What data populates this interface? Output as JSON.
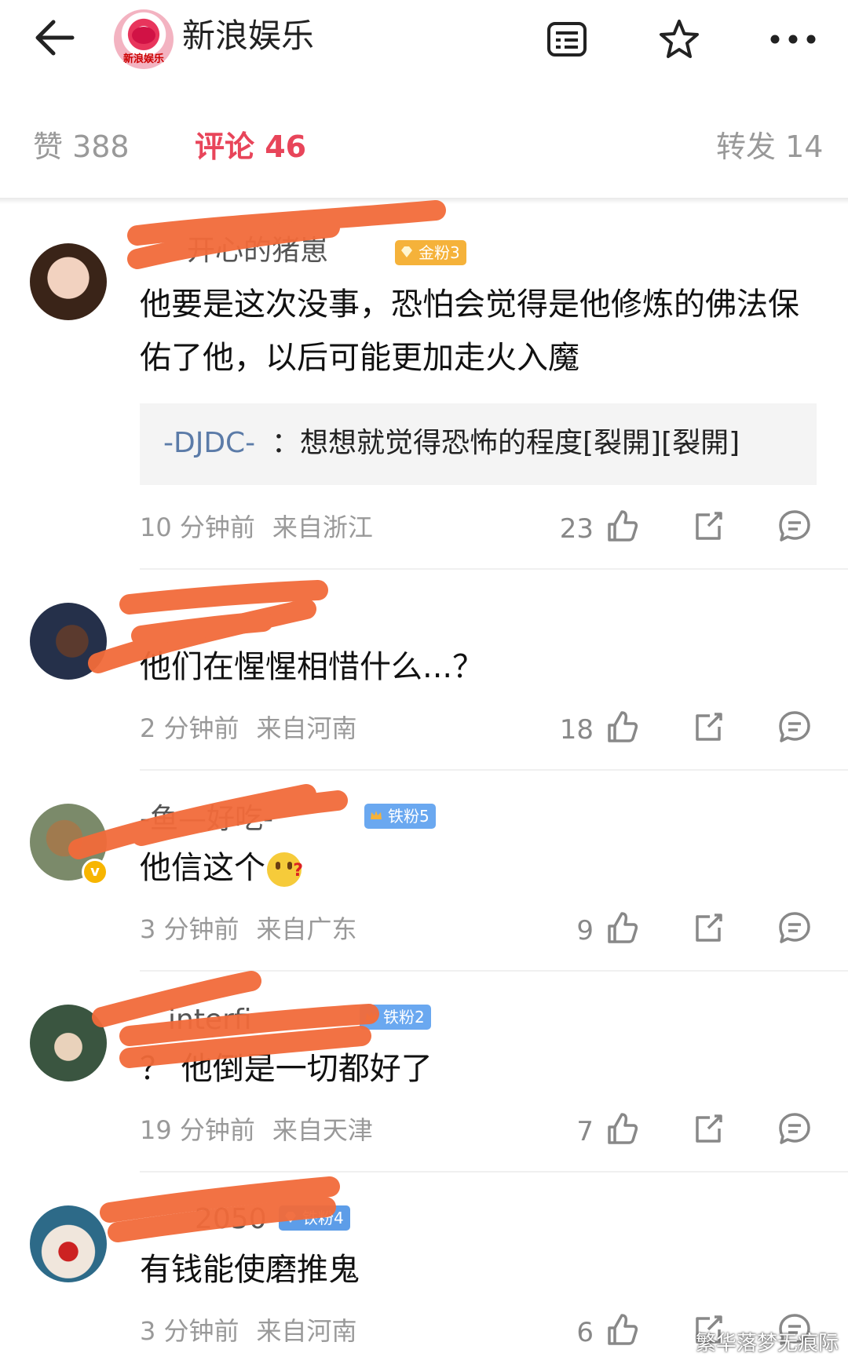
{
  "header": {
    "title": "新浪娱乐",
    "logo_text": "新浪娱乐",
    "icons": [
      "back-arrow-icon",
      "list-icon",
      "star-icon",
      "more-icon"
    ]
  },
  "tabs": [
    {
      "label": "赞 388",
      "active": false
    },
    {
      "label": "评论 46",
      "active": true
    },
    {
      "label": "转发 14",
      "active": false
    }
  ],
  "colors": {
    "accent": "#e8455a",
    "reply_user": "#5b7ba8",
    "scribble": "#f26b3a",
    "gold_badge": "#f5b23a",
    "iron_badge": "#6aa8f0"
  },
  "comments": [
    {
      "name": "开心的猪崽",
      "badge": "金粉3",
      "text": "他要是这次没事，恐怕会觉得是他修炼的佛法保佑了他，以后可能更加走火入魔",
      "reply_user": "-DJDC-",
      "reply_text": "：想想就觉得恐怖的程度[裂開][裂開]",
      "time": "10 分钟前",
      "location": "来自浙江",
      "likes": "23"
    },
    {
      "name": "",
      "badge": "",
      "text": "他们在惺惺相惜什么...？",
      "time": "2 分钟前",
      "location": "来自河南",
      "likes": "18"
    },
    {
      "name": "-鱼—好吃-",
      "badge": "铁粉5",
      "text": "他信这个",
      "time": "3 分钟前",
      "location": "来自广东",
      "likes": "9"
    },
    {
      "name": "interfi",
      "badge": "铁粉2",
      "text": "？ 他倒是一切都好了",
      "time": "19 分钟前",
      "location": "来自天津",
      "likes": "7"
    },
    {
      "name": "2050",
      "badge": "铁粉4",
      "text": "有钱能使磨推鬼",
      "time": "3 分钟前",
      "location": "来自河南",
      "likes": "6"
    }
  ],
  "watermark": "繁华落梦无痕际"
}
